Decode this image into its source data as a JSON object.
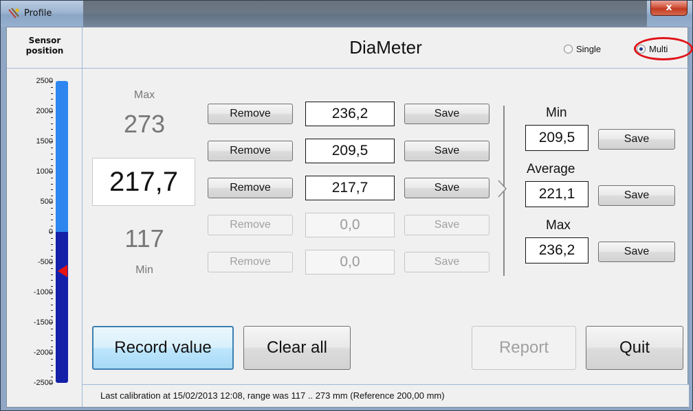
{
  "window": {
    "title": "Profile",
    "close_label": "x"
  },
  "sensor": {
    "title_line1": "Sensor",
    "title_line2": "position",
    "scale_labels": [
      "2500",
      "2000",
      "1500",
      "1000",
      "500",
      "0",
      "-500",
      "-1000",
      "-1500",
      "-2000",
      "-2500"
    ],
    "scale_max": 2500,
    "scale_min": -2500,
    "position_value": -650,
    "colors": {
      "upper": "#2d86f0",
      "lower": "#1420a8",
      "marker": "#e8140e"
    }
  },
  "header": {
    "title": "DiaMeter",
    "mode_single": "Single",
    "mode_multi": "Multi",
    "selected_mode": "Multi"
  },
  "readout": {
    "max_label": "Max",
    "max_value": "273",
    "current_value": "217,7",
    "min_value": "117",
    "min_label": "Min"
  },
  "measurements": [
    {
      "remove": "Remove",
      "value": "236,2",
      "save": "Save",
      "enabled": true
    },
    {
      "remove": "Remove",
      "value": "209,5",
      "save": "Save",
      "enabled": true
    },
    {
      "remove": "Remove",
      "value": "217,7",
      "save": "Save",
      "enabled": true
    },
    {
      "remove": "Remove",
      "value": "0,0",
      "save": "Save",
      "enabled": false
    },
    {
      "remove": "Remove",
      "value": "0,0",
      "save": "Save",
      "enabled": false
    }
  ],
  "stats": {
    "min_label": "Min",
    "min_value": "209,5",
    "average_label": "Average",
    "average_value": "221,1",
    "max_label": "Max",
    "max_value": "236,2",
    "save_label": "Save"
  },
  "actions": {
    "record": "Record value",
    "clear": "Clear all",
    "report": "Report",
    "quit": "Quit"
  },
  "status": "Last calibration at 15/02/2013 12:08, range was 117 .. 273 mm (Reference 200,00 mm)"
}
